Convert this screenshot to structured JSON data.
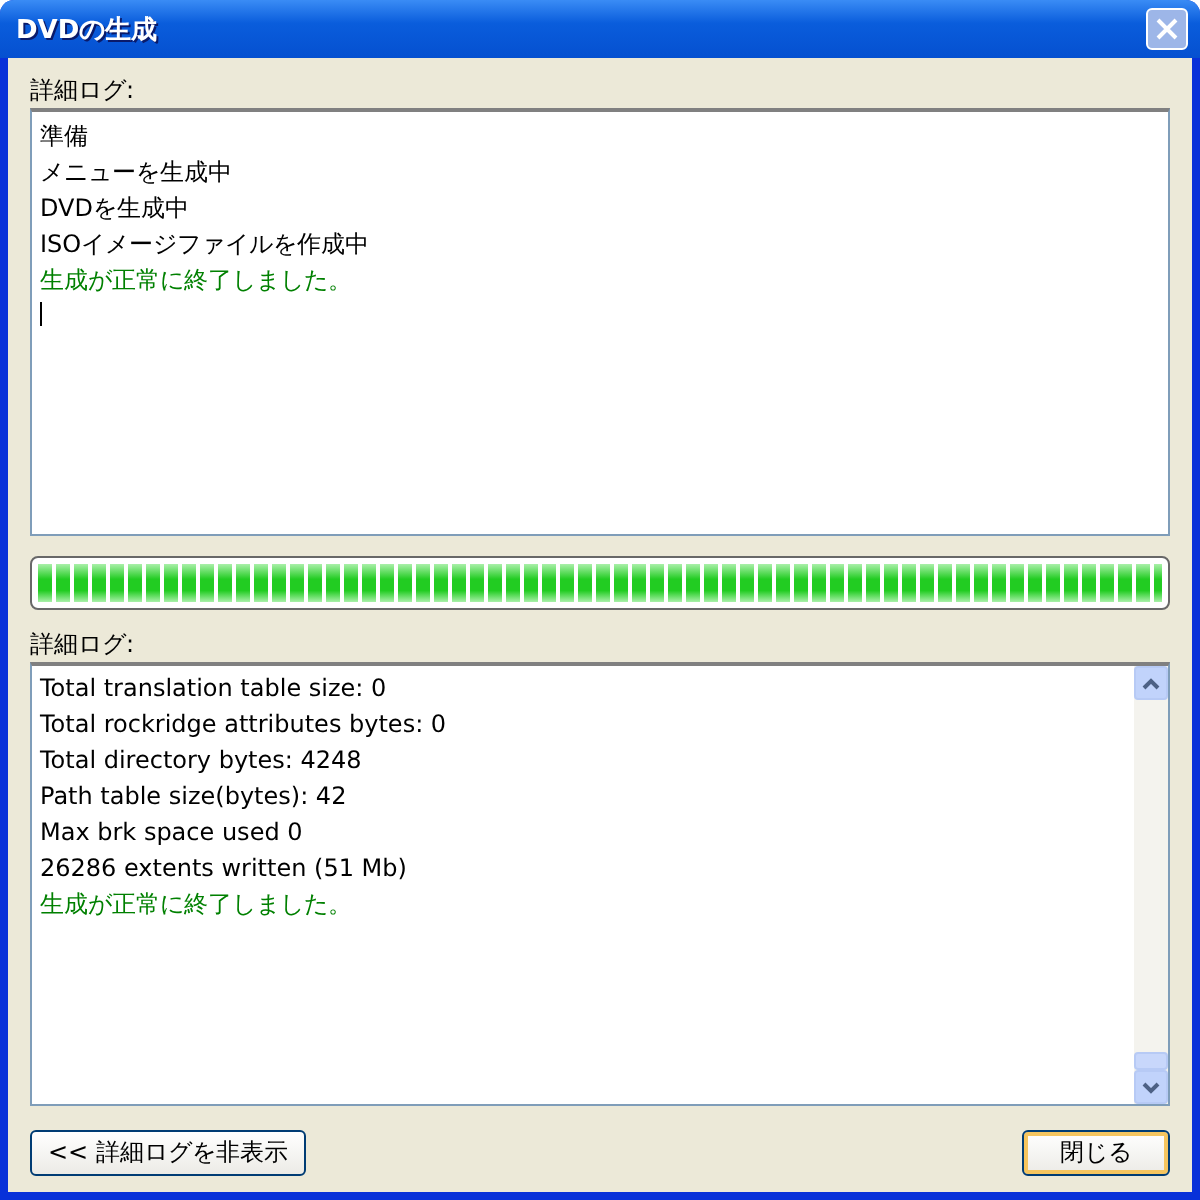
{
  "window": {
    "title": "DVDの生成"
  },
  "upper_log": {
    "label": "詳細ログ:",
    "lines": [
      {
        "text": "準備",
        "kind": "normal"
      },
      {
        "text": "メニューを生成中",
        "kind": "normal"
      },
      {
        "text": "DVDを生成中",
        "kind": "normal"
      },
      {
        "text": "ISOイメージファイルを作成中",
        "kind": "normal"
      },
      {
        "text": "生成が正常に終了しました。",
        "kind": "success"
      }
    ]
  },
  "progress": {
    "level": 1
  },
  "lower_log": {
    "label": "詳細ログ:",
    "lines": [
      {
        "text": "Total translation table size: 0",
        "kind": "normal"
      },
      {
        "text": "Total rockridge attributes bytes: 0",
        "kind": "normal"
      },
      {
        "text": "Total directory bytes: 4248",
        "kind": "normal"
      },
      {
        "text": "Path table size(bytes): 42",
        "kind": "normal"
      },
      {
        "text": "Max brk space used 0",
        "kind": "normal"
      },
      {
        "text": "26286 extents written (51 Mb)",
        "kind": "normal"
      },
      {
        "text": "生成が正常に終了しました。",
        "kind": "success"
      }
    ]
  },
  "buttons": [
    {
      "label": "<< 詳細ログを非表示",
      "kind": "toggle"
    },
    {
      "label": "閉じる",
      "kind": "close"
    }
  ]
}
